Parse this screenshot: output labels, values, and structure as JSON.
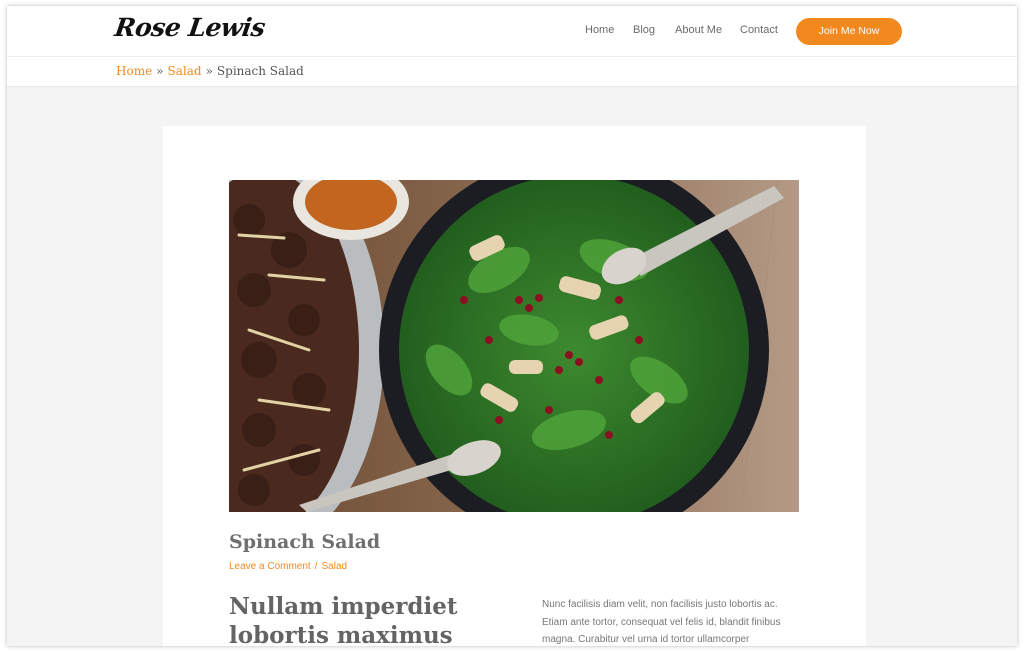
{
  "site": {
    "logo_text": "Rose Lewis"
  },
  "nav": {
    "items": [
      {
        "label": "Home"
      },
      {
        "label": "Blog"
      },
      {
        "label": "About Me"
      },
      {
        "label": "Contact"
      }
    ],
    "cta_label": "Join Me Now"
  },
  "breadcrumb": {
    "items": [
      "Home",
      "Salad",
      "Spinach Salad"
    ],
    "separator": "»"
  },
  "post": {
    "title": "Spinach Salad",
    "meta": {
      "comment_link": "Leave a Comment",
      "separator": "/",
      "category": "Salad"
    },
    "heading": "Nullam imperdiet lobortis maximus",
    "paragraph": "Nunc facilisis diam velit, non facilisis justo lobortis ac. Etiam ante tortor, consequat vel felis id, blandit finibus magna. Curabitur vel urna id tortor ullamcorper",
    "image": "salad-bowl-photo"
  },
  "colors": {
    "accent": "#f2891f",
    "page_background": "#f4f4f4",
    "text_heading": "#6f6f6f",
    "text_body": "#777777"
  }
}
